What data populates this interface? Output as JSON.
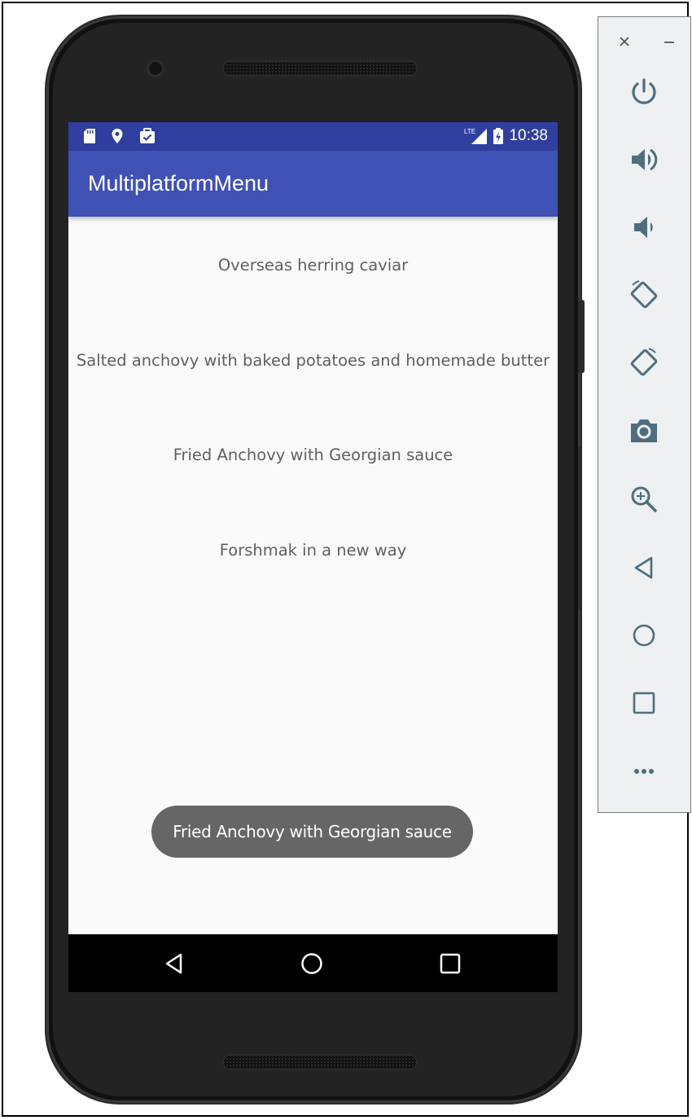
{
  "status_bar": {
    "left_icons": [
      "sd-card-icon",
      "location-icon",
      "clipboard-check-icon"
    ],
    "network": "LTE",
    "time": "10:38"
  },
  "app": {
    "title": "MultiplatformMenu"
  },
  "menu": {
    "items": [
      "Overseas herring caviar",
      "Salted anchovy with baked potatoes and homemade butter",
      "Fried Anchovy with Georgian sauce",
      "Forshmak in a new way"
    ]
  },
  "toast": {
    "text": "Fried Anchovy with Georgian sauce"
  },
  "navigation": {
    "buttons": [
      "back-icon",
      "home-icon",
      "recents-icon"
    ]
  },
  "emulator_toolbar": {
    "window_buttons": [
      "close-icon",
      "minimize-icon"
    ],
    "controls": [
      "power-icon",
      "volume-up-icon",
      "volume-down-icon",
      "rotate-left-icon",
      "rotate-right-icon",
      "camera-icon",
      "zoom-icon",
      "back-icon",
      "home-icon",
      "overview-icon",
      "more-icon"
    ]
  },
  "colors": {
    "status_bar": "#303f9f",
    "app_bar": "#3f51b5",
    "screen_bg": "#fafafa",
    "menu_text": "#5f5f5f",
    "toast_bg": "#666666",
    "toolbar_icon": "#4e6e7e"
  }
}
